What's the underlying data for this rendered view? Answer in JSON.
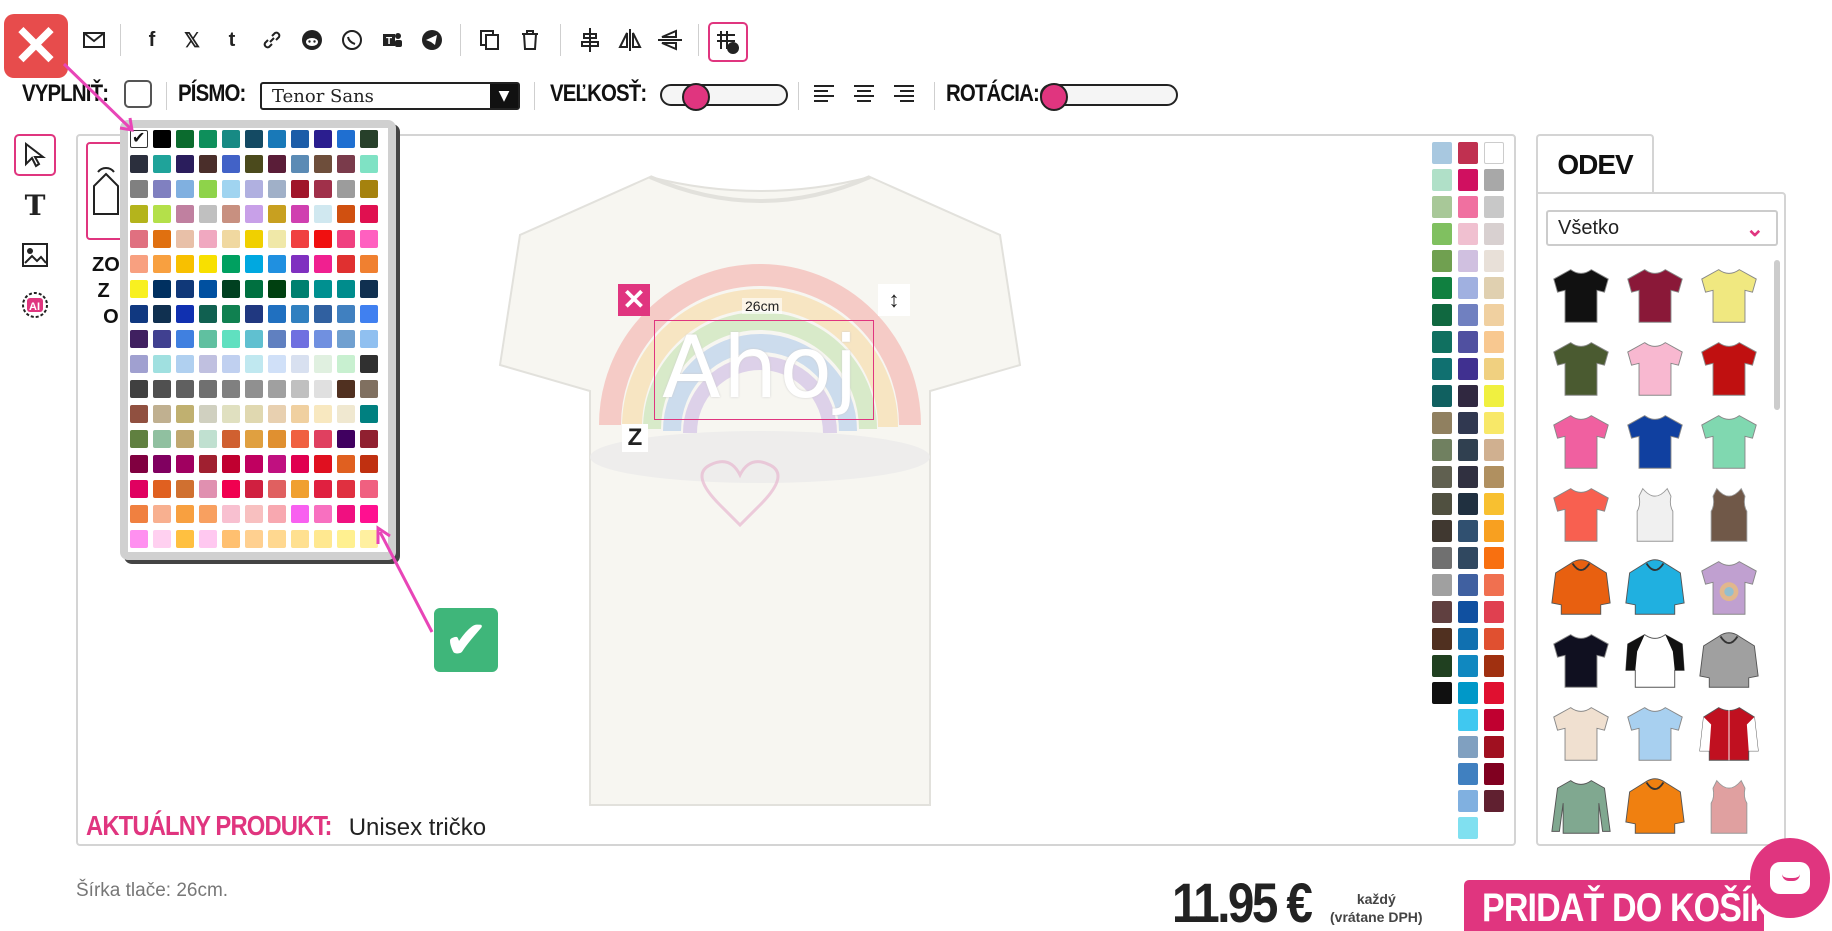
{
  "toolbar": {
    "icons": [
      "close-icon",
      "email-icon",
      "facebook-icon",
      "x-twitter-icon",
      "tumblr-icon",
      "link-icon",
      "reddit-icon",
      "whatsapp-icon",
      "teams-icon",
      "telegram-icon",
      "duplicate-icon",
      "trash-icon",
      "align-center-icon",
      "flip-horizontal-icon",
      "flip-vertical-icon",
      "grid-select-icon"
    ]
  },
  "props": {
    "fill_label": "VYPLNIŤ:",
    "font_label": "PÍSMO:",
    "font_value": "Tenor Sans",
    "size_label": "VEĽKOSŤ:",
    "rotation_label": "ROTÁCIA:",
    "size_level": 0.25,
    "rotation_level": 0.0
  },
  "canvas": {
    "zone_text": "ZO\nZA\nO",
    "design_text": "Ahoj",
    "size_label": "26cm",
    "product_label": "AKTUÁLNY PRODUKT:",
    "product_name": "Unisex tričko"
  },
  "palette": {
    "selected": "white",
    "colors": [
      "#ffffff",
      "#000000",
      "#0b6b2e",
      "#0e8f5b",
      "#178a84",
      "#144a63",
      "#1979b8",
      "#1c5da8",
      "#2b1e8f",
      "#1f6fd1",
      "#27402a",
      "#2b2f3d",
      "#1fa39a",
      "#2a1d5c",
      "#4a2e2a",
      "#4262c7",
      "#4b4a1c",
      "#5a1d38",
      "#5b8bb5",
      "#6e4e3b",
      "#7a3b4b",
      "#7fe2c4",
      "#808080",
      "#8080c0",
      "#80b0e0",
      "#8ed34a",
      "#a0d4f0",
      "#b0b0e0",
      "#a0b0c8",
      "#a0152a",
      "#a0304a",
      "#9c9c9c",
      "#a5820e",
      "#b4b41c",
      "#b4e04a",
      "#c080a0",
      "#c0c0c0",
      "#c89080",
      "#c8a0e8",
      "#c8a020",
      "#d040b0",
      "#d0e8f0",
      "#d05010",
      "#e01050",
      "#e07080",
      "#e07010",
      "#e8c0a8",
      "#f0a8c0",
      "#f0d8a0",
      "#f0d000",
      "#f0e8a8",
      "#f04040",
      "#f01010",
      "#f04080",
      "#ff60c0",
      "#f8a080",
      "#f8a040",
      "#f8c000",
      "#f8e000",
      "#00a060",
      "#00a8e0",
      "#2090e0",
      "#8030c0",
      "#f02090",
      "#e03030",
      "#f08030",
      "#f8f020",
      "#003060",
      "#103878",
      "#0050a0",
      "#004020",
      "#007040",
      "#004010",
      "#008070",
      "#009090",
      "#008c8c",
      "#103050",
      "#103880",
      "#103050",
      "#1030b0",
      "#106050",
      "#108050",
      "#203880",
      "#2070c0",
      "#3080c0",
      "#3060a0",
      "#4080c0",
      "#4080f0",
      "#402060",
      "#404090",
      "#4080e0",
      "#60c0a0",
      "#60e0c0",
      "#60c0d0",
      "#6080c0",
      "#7070e0",
      "#7090e0",
      "#70a0d0",
      "#90c0f0",
      "#a0a0d0",
      "#a0e0e0",
      "#b0d0f0",
      "#c0c0e0",
      "#c0d0f0",
      "#c0e8f0",
      "#d0e0f8",
      "#d8e0f0",
      "#e0f0e0",
      "#c8f0d0",
      "#303030",
      "#404040",
      "#505050",
      "#606060",
      "#707070",
      "#808080",
      "#909090",
      "#a0a0a0",
      "#c0c0c0",
      "#e0e0e0",
      "#503020",
      "#807060",
      "#905040",
      "#c0b090",
      "#c0b070",
      "#d0d0c0",
      "#e0e0c0",
      "#e0d8b0",
      "#e8d0b0",
      "#f0d0a0",
      "#f8e8c0",
      "#f0e8d0",
      "#008080",
      "#608040",
      "#90c0a0",
      "#c0a870",
      "#c0e0d0",
      "#d06030",
      "#e0a040",
      "#e09030",
      "#f06040",
      "#e04060",
      "#400060",
      "#902030",
      "#800040",
      "#800060",
      "#a00060",
      "#a02030",
      "#c00030",
      "#c00060",
      "#c01080",
      "#e00050",
      "#e01020",
      "#e06020",
      "#c03010",
      "#e00060",
      "#e06020",
      "#d07030",
      "#e090b0",
      "#f00050",
      "#d02040",
      "#e06060",
      "#f0a030",
      "#e02040",
      "#e03040",
      "#f06080",
      "#f08040",
      "#f8b090",
      "#f8a040",
      "#f8a060",
      "#f8c0d0",
      "#f8c0c0",
      "#f8a8b0",
      "#f860f0",
      "#f870c0",
      "#f01080",
      "#ff1090",
      "#ff90f0",
      "#ffd0f0",
      "#ffc040",
      "#ffc8f0",
      "#ffc070",
      "#ffd090",
      "#ffd890",
      "#ffe090",
      "#ffe890",
      "#fff090",
      "#fff0a0"
    ]
  },
  "right_colors": {
    "col1": [
      "#a8c8e0",
      "#b0e0c8",
      "#a8c898",
      "#80c060",
      "#70a050",
      "#108040",
      "#106840",
      "#107060",
      "#107070",
      "#106060",
      "#908060",
      "#708060",
      "#606050",
      "#505040",
      "#403830",
      "#707070",
      "#a0a0a0",
      "#604040",
      "#503020",
      "#204020",
      "#101010"
    ],
    "col2": [
      "#c03050",
      "#d01060",
      "#f070a0",
      "#f0c0d0",
      "#d0c0e0",
      "#a0b0e0",
      "#7080c0",
      "#5050a0",
      "#403090",
      "#302840",
      "#303850",
      "#304050",
      "#303040",
      "#203040",
      "#305070",
      "#304860",
      "#4060a0",
      "#1050a0",
      "#1070b0",
      "#1088c0",
      "#0098c8",
      "#40c8f0",
      "#80a0c0",
      "#4080c0",
      "#80b0e0",
      "#80e0f0"
    ],
    "col3": [
      "#ffffff",
      "#a8a8a8",
      "#c8c8c8",
      "#d8d0d0",
      "#e8e0d8",
      "#e0d0b0",
      "#f0d0a0",
      "#f8c890",
      "#f0d080",
      "#f0f040",
      "#f8e868",
      "#d0b090",
      "#b09060",
      "#f8c030",
      "#f8a020",
      "#f87010",
      "#f07050",
      "#e04050",
      "#e05030",
      "#a03010",
      "#e01030",
      "#c00030",
      "#a01020",
      "#800020",
      "#602030"
    ]
  },
  "odev": {
    "tab": "ODEV",
    "filter": "Všetko",
    "garments": [
      {
        "name": "tshirt",
        "color": "#111111"
      },
      {
        "name": "tshirt",
        "color": "#8a1838"
      },
      {
        "name": "tshirt",
        "color": "#f0e880"
      },
      {
        "name": "tshirt",
        "color": "#4a5a30"
      },
      {
        "name": "tshirt-women",
        "color": "#f8b8d0"
      },
      {
        "name": "tshirt",
        "color": "#c01010"
      },
      {
        "name": "tshirt-women",
        "color": "#f060a0"
      },
      {
        "name": "tshirt",
        "color": "#1040a0"
      },
      {
        "name": "tshirt",
        "color": "#80d8b0"
      },
      {
        "name": "tshirt-women",
        "color": "#f86050"
      },
      {
        "name": "tank-top",
        "color": "#f0f0f0"
      },
      {
        "name": "tank-top",
        "color": "#705848"
      },
      {
        "name": "hoodie",
        "color": "#e86010"
      },
      {
        "name": "hoodie",
        "color": "#20b0e0"
      },
      {
        "name": "tshirt-tiedye",
        "color": "#c0a0d0"
      },
      {
        "name": "tshirt",
        "color": "#101020"
      },
      {
        "name": "raglan",
        "color": "#ffffff"
      },
      {
        "name": "hoodie",
        "color": "#a0a0a0"
      },
      {
        "name": "tshirt",
        "color": "#f0e0d0"
      },
      {
        "name": "tshirt",
        "color": "#a8d0f0"
      },
      {
        "name": "varsity-jacket",
        "color": "#c01020"
      },
      {
        "name": "longsleeve",
        "color": "#80a890"
      },
      {
        "name": "hoodie",
        "color": "#f08010"
      },
      {
        "name": "tank-top",
        "color": "#e0a0a0"
      }
    ]
  },
  "footer": {
    "width_note": "Šírka tlače: 26cm.",
    "price": "11.95 €",
    "price_note_1": "každý",
    "price_note_2": "(vrátane DPH)",
    "cart_button": "PRIDAŤ DO KOŠÍKA"
  },
  "colors": {
    "accent": "#e0357f",
    "close": "#e74c4c",
    "confirm": "#3fb67a"
  }
}
